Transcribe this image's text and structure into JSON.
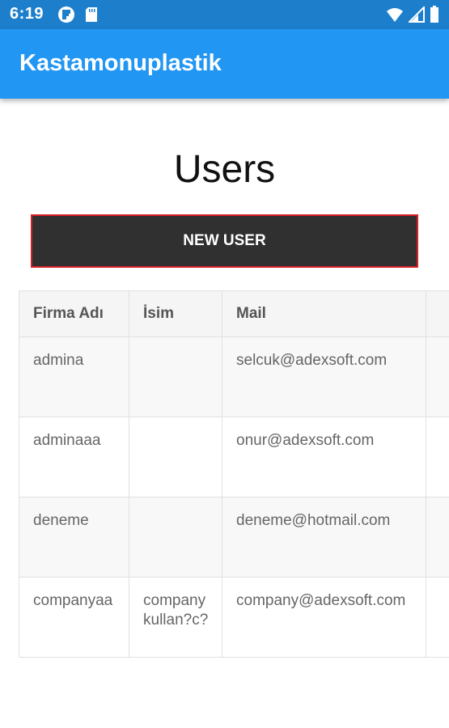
{
  "status_bar": {
    "time": "6:19",
    "left_icons": [
      "flipboard-icon",
      "sd-card-icon"
    ],
    "right_icons": [
      "wifi-icon",
      "signal-icon",
      "battery-icon"
    ]
  },
  "app_bar": {
    "title": "Kastamonuplastik"
  },
  "page": {
    "title": "Users",
    "new_user_button": "NEW USER"
  },
  "table": {
    "headers": [
      "Firma Adı",
      "İsim",
      "Mail"
    ],
    "rows": [
      {
        "firma": "admina",
        "isim": "",
        "mail": "selcuk@adexsoft.com"
      },
      {
        "firma": "adminaaa",
        "isim": "",
        "mail": "onur@adexsoft.com"
      },
      {
        "firma": "deneme",
        "isim": "",
        "mail": "deneme@hotmail.com"
      },
      {
        "firma": "companyaa",
        "isim": "company kullan?c?",
        "mail": "company@adexsoft.com"
      }
    ]
  },
  "colors": {
    "status_bar": "#1d7fcc",
    "app_bar": "#2196f3",
    "button_bg": "#303030",
    "button_border": "#d71f25"
  }
}
